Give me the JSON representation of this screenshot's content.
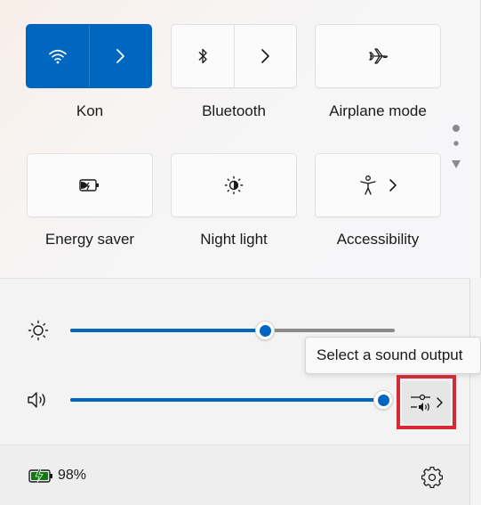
{
  "tiles": [
    {
      "label": "Kon",
      "main_icon": "wifi-icon",
      "secondary_icon": "chevron-right-icon",
      "active": true
    },
    {
      "label": "Bluetooth",
      "main_icon": "bluetooth-icon",
      "secondary_icon": "chevron-right-icon",
      "active": false
    },
    {
      "label": "Airplane mode",
      "main_icon": "airplane-icon",
      "active": false
    },
    {
      "label": "Energy saver",
      "main_icon": "energy-saver-icon",
      "active": false
    },
    {
      "label": "Night light",
      "main_icon": "night-light-icon",
      "active": false
    },
    {
      "label": "Accessibility",
      "main_icon": "accessibility-icon",
      "secondary_icon": "chevron-right-icon",
      "active": false
    }
  ],
  "pages": {
    "count": 2,
    "current": 1
  },
  "brightness": {
    "icon": "brightness-icon",
    "level": 0.6
  },
  "volume": {
    "icon": "speaker-icon",
    "level": 1.0
  },
  "tooltip": {
    "text": "Select a sound output"
  },
  "sound_output": {
    "icon": "sound-output-icon",
    "chevron": "chevron-right-icon"
  },
  "battery": {
    "icon": "battery-charging-icon",
    "percent": "98%"
  },
  "settings": {
    "icon": "gear-icon"
  },
  "colors": {
    "accent": "#0067c0",
    "track_inactive": "#8a8a8a",
    "highlight_border": "#d32a35"
  }
}
